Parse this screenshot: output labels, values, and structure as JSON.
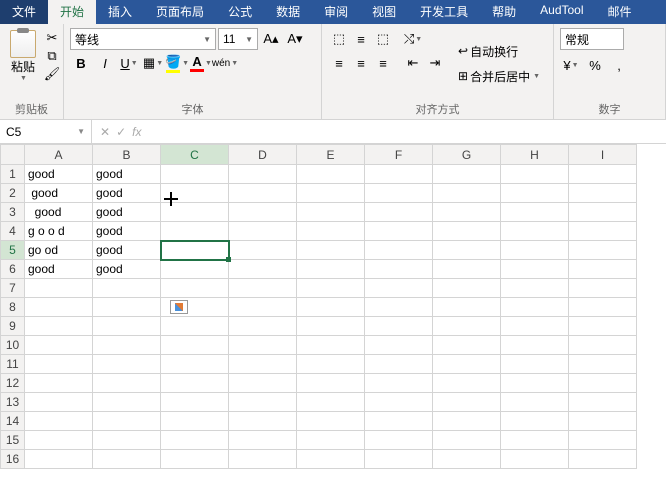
{
  "tabs": {
    "file": "文件",
    "home": "开始",
    "insert": "插入",
    "layout": "页面布局",
    "formulas": "公式",
    "data": "数据",
    "review": "审阅",
    "view": "视图",
    "dev": "开发工具",
    "help": "帮助",
    "audtool": "AudTool",
    "mail": "邮件"
  },
  "ribbon": {
    "clipboard": {
      "label": "剪贴板",
      "paste": "粘贴"
    },
    "font": {
      "label": "字体",
      "name": "等线",
      "size": "11",
      "bold": "B",
      "italic": "I",
      "underline": "U",
      "phonetic": "wén"
    },
    "align": {
      "label": "对齐方式",
      "wrap": "自动换行",
      "merge": "合并后居中"
    },
    "number": {
      "label": "数字",
      "format": "常规",
      "percent": "%",
      "comma": ","
    }
  },
  "namebox": "C5",
  "fx_symbol": "fx",
  "columns": [
    "A",
    "B",
    "C",
    "D",
    "E",
    "F",
    "G",
    "H",
    "I"
  ],
  "rows": [
    "1",
    "2",
    "3",
    "4",
    "5",
    "6",
    "7",
    "8",
    "9",
    "10",
    "11",
    "12",
    "13",
    "14",
    "15",
    "16"
  ],
  "cells": {
    "A1": "good",
    "B1": "good",
    "A2": " good",
    "B2": "good",
    "A3": "  good",
    "B3": "good",
    "A4": "g o o d",
    "B4": "good",
    "A5": "go od",
    "B5": "good",
    "A6": "good",
    "B6": "good"
  },
  "selected_cell": "C5",
  "active_row": "5",
  "active_col": "C"
}
